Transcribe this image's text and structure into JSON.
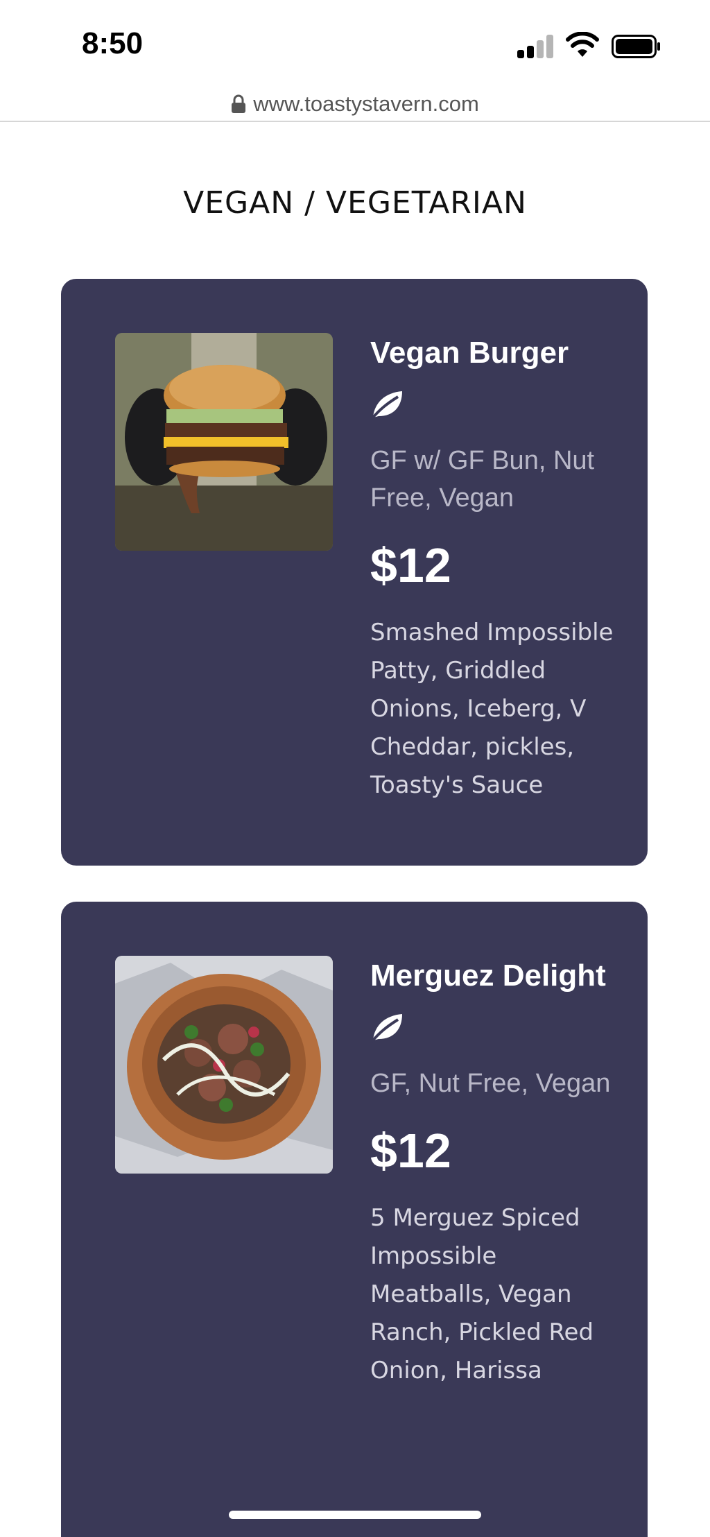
{
  "status_bar": {
    "time": "8:50"
  },
  "browser": {
    "url": "www.toastystavern.com"
  },
  "page": {
    "section_title": "VEGAN / VEGETARIAN"
  },
  "menu_items": [
    {
      "name": "Vegan Burger",
      "tags": "GF w/ GF Bun, Nut Free, Vegan",
      "price": "$12",
      "description": "Smashed Impossible Patty, Griddled Onions, Iceberg, V Cheddar, pickles, Toasty's Sauce",
      "icon": "leaf-icon"
    },
    {
      "name": "Merguez Delight",
      "tags": "GF, Nut Free, Vegan",
      "price": "$12",
      "description": "5 Merguez Spiced Impossible Meatballs, Vegan Ranch, Pickled Red Onion, Harissa",
      "icon": "leaf-icon"
    }
  ],
  "colors": {
    "card_bg": "#3a3957",
    "tag_text": "#b9b8c8",
    "page_bg": "#ffffff"
  }
}
